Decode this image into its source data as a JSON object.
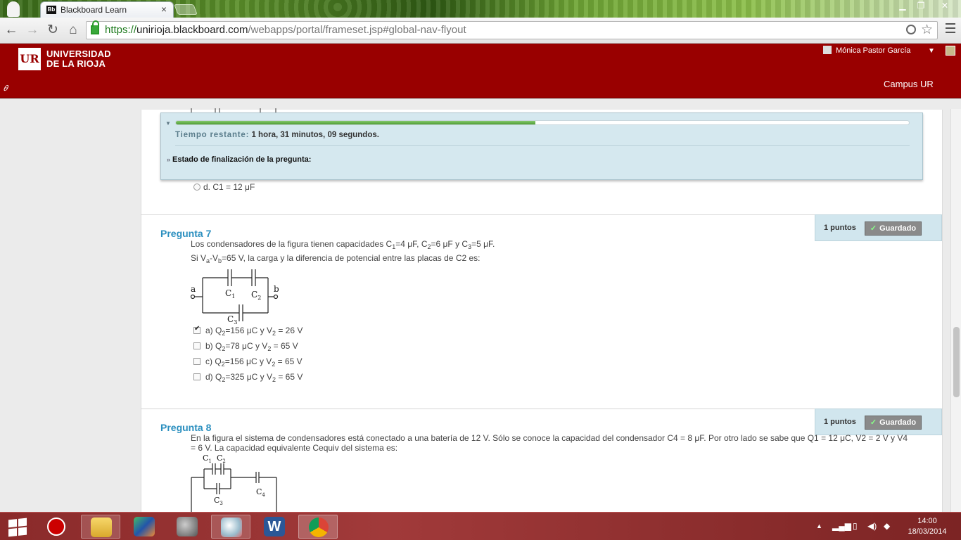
{
  "browser": {
    "tab_title": "Blackboard Learn",
    "tab_favicon": "Bb",
    "url_scheme": "https://",
    "url_host": "unirioja.blackboard.com",
    "url_path": "/webapps/portal/frameset.jsp#global-nav-flyout"
  },
  "header": {
    "logo_mark": "UR",
    "logo_line1": "UNIVERSIDAD",
    "logo_line2": "DE LA RIOJA",
    "user_name": "Mónica Pastor García",
    "campus_link": "Campus UR"
  },
  "timer": {
    "progress": 0.49,
    "label": "Tiempo restante:",
    "value": "1 hora, 31 minutos, 09 segundos.",
    "status_label": "Estado de finalización de la pregunta:"
  },
  "prev_question": {
    "visible_option": "d. C1 = 12 μF"
  },
  "q7": {
    "title": "Pregunta 7",
    "points": "1 puntos",
    "saved": "Guardado",
    "line1_a": "Los condensadores de la figura tienen capacidades C",
    "line1_s1": "1",
    "line1_b": "=4 μF, C",
    "line1_s2": "2",
    "line1_c": "=6 μF y C",
    "line1_s3": "3",
    "line1_d": "=5 μF.",
    "line2_a": "Si V",
    "line2_s1": "a",
    "line2_b": "-V",
    "line2_s2": "b",
    "line2_c": "=65 V, la carga y la diferencia de potencial entre las placas de C2 es:",
    "fig": {
      "a": "a",
      "b": "b",
      "c1": "C",
      "c1s": "1",
      "c2": "C",
      "c2s": "2",
      "c3": "C",
      "c3s": "3"
    },
    "options": [
      {
        "p": "a) Q",
        "s1": "2",
        "m": "=156 μC y V",
        "s2": "2",
        "e": " = 26 V",
        "checked": true
      },
      {
        "p": "b) Q",
        "s1": "2",
        "m": "=78 μC y V",
        "s2": "2",
        "e": " = 65 V",
        "checked": false
      },
      {
        "p": "c) Q",
        "s1": "2",
        "m": "=156 μC y V",
        "s2": "2",
        "e": " = 65 V",
        "checked": false
      },
      {
        "p": "d) Q",
        "s1": "2",
        "m": "=325 μC y V",
        "s2": "2",
        "e": " = 65 V",
        "checked": false
      }
    ]
  },
  "q8": {
    "title": "Pregunta 8",
    "points": "1 puntos",
    "saved": "Guardado",
    "text_line1": "En la figura el sistema de condensadores está conectado a una batería de 12 V. Sólo se conoce la capacidad del condensador C4 = 8 μF. Por otro lado se sabe que Q1 = 12 μC, V2 = 2 V y V4",
    "text_line2": "= 6 V. La capacidad equivalente Cequiv del sistema es:",
    "fig": {
      "c1": "C",
      "c1s": "1",
      "c2": "C",
      "c2s": "2",
      "c3": "C",
      "c3s": "3",
      "c4": "C",
      "c4s": "4"
    }
  },
  "taskbar": {
    "time": "14:00",
    "date": "18/03/2014"
  },
  "colors": {
    "brand": "#990000",
    "accent": "#2b8fbf",
    "timer_bg": "#d5e8ef"
  }
}
